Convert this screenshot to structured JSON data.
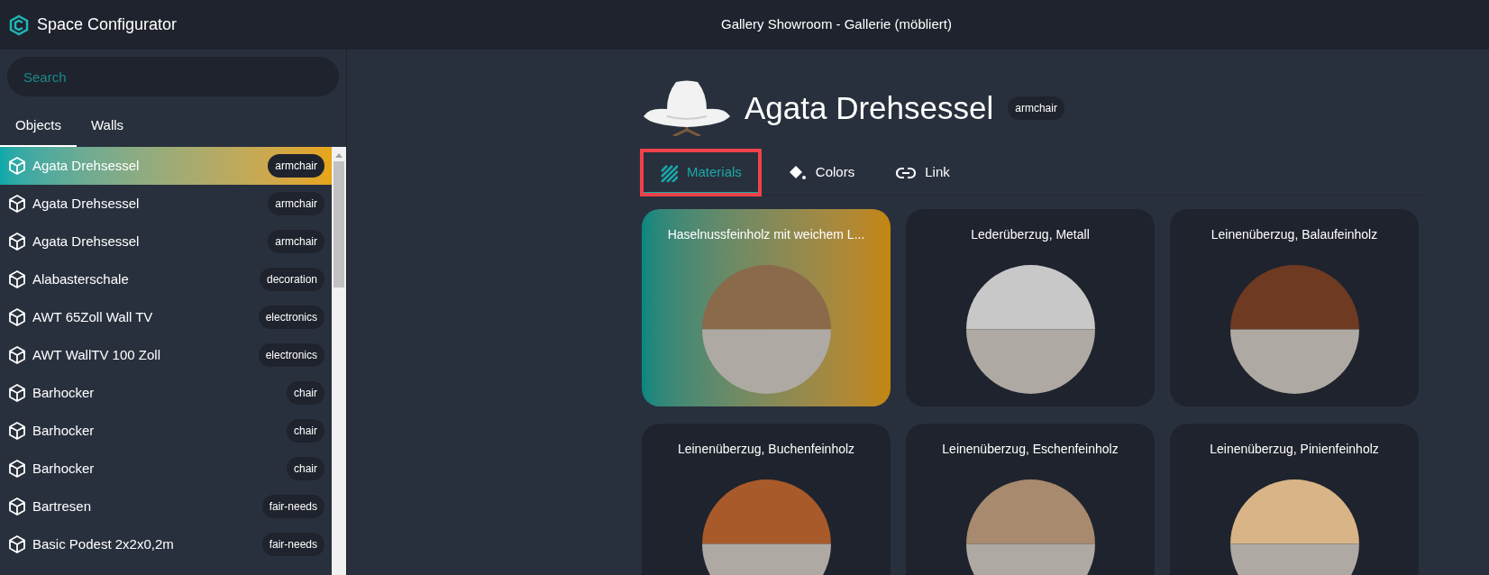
{
  "app": {
    "name": "Space Configurator"
  },
  "window": {
    "title": "Gallery Showroom - Gallerie (möbliert)"
  },
  "search": {
    "placeholder": "Search"
  },
  "sidebar_tabs": [
    {
      "label": "Objects",
      "selected": true
    },
    {
      "label": "Walls",
      "selected": false
    }
  ],
  "objects": [
    {
      "name": "Agata Drehsessel",
      "tag": "armchair",
      "selected": true
    },
    {
      "name": "Agata Drehsessel",
      "tag": "armchair",
      "selected": false
    },
    {
      "name": "Agata Drehsessel",
      "tag": "armchair",
      "selected": false
    },
    {
      "name": "Alabasterschale",
      "tag": "decoration",
      "selected": false
    },
    {
      "name": "AWT 65Zoll Wall TV",
      "tag": "electronics",
      "selected": false
    },
    {
      "name": "AWT WallTV 100 Zoll",
      "tag": "electronics",
      "selected": false
    },
    {
      "name": "Barhocker",
      "tag": "chair",
      "selected": false
    },
    {
      "name": "Barhocker",
      "tag": "chair",
      "selected": false
    },
    {
      "name": "Barhocker",
      "tag": "chair",
      "selected": false
    },
    {
      "name": "Bartresen",
      "tag": "fair-needs",
      "selected": false
    },
    {
      "name": "Basic Podest 2x2x0,2m",
      "tag": "fair-needs",
      "selected": false
    }
  ],
  "detail": {
    "title": "Agata Drehsessel",
    "tag": "armchair",
    "tabs": [
      {
        "label": "Materials",
        "kind": "materials",
        "selected": true,
        "highlighted": true
      },
      {
        "label": "Colors",
        "kind": "colors",
        "selected": false,
        "highlighted": false
      },
      {
        "label": "Link",
        "kind": "link",
        "selected": false,
        "highlighted": false
      }
    ],
    "materials": [
      {
        "name": "Haselnussfeinholz mit weichem L...",
        "selected": true,
        "color": "#8a6a4a"
      },
      {
        "name": "Lederüberzug, Metall",
        "selected": false,
        "color": "#c8c8c8"
      },
      {
        "name": "Leinenüberzug, Balaufeinholz",
        "selected": false,
        "color": "#6e3a22"
      },
      {
        "name": "Leinenüberzug, Buchenfeinholz",
        "selected": false,
        "color": "#a85a2a"
      },
      {
        "name": "Leinenüberzug, Eschenfeinholz",
        "selected": false,
        "color": "#a88a6e"
      },
      {
        "name": "Leinenüberzug, Pinienfeinholz",
        "selected": false,
        "color": "#d9b487"
      }
    ]
  }
}
